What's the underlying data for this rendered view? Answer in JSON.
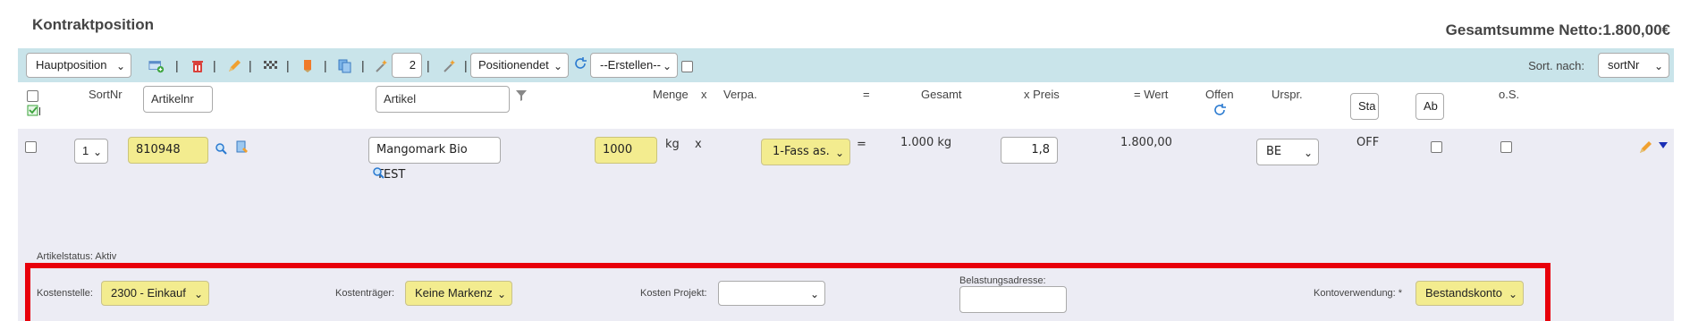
{
  "header": {
    "title": "Kontraktposition",
    "total": "Gesamtsumme Netto:1.800,00€"
  },
  "toolbar": {
    "position_type": "Hauptposition",
    "copies_value": "2",
    "positions_select": "Positionendet",
    "create_select": "--Erstellen--",
    "sort_label": "Sort. nach:",
    "sort_select": "sortNr",
    "separator": "|"
  },
  "columns": {
    "sortnr": "SortNr",
    "artikelnr_placeholder": "Artikelnr",
    "artikel_placeholder": "Artikel",
    "menge": "Menge",
    "x1": "x",
    "verpa": "Verpa.",
    "eq": "=",
    "gesamt": "Gesamt",
    "xpreis": "x Preis",
    "wert": "= Wert",
    "offen": "Offen",
    "urspr": "Urspr.",
    "sta_placeholder": "Sta",
    "ab_placeholder": "Ab",
    "os": "o.S."
  },
  "row": {
    "sortnr": "1",
    "artikelnr": "810948",
    "artikel": "Mangomark Bio TEST",
    "menge": "1000",
    "unit": "kg",
    "x": "x",
    "verpackung": "1-Fass as.",
    "eq": "=",
    "gesamt": "1.000 kg",
    "preis": "1,8",
    "wert": "1.800,00",
    "urspr": "BE",
    "status_toggle": "OFF",
    "artikelstatus": "Artikelstatus: Aktiv"
  },
  "cost": {
    "kostenstelle_label": "Kostenstelle:",
    "kostenstelle_value": "2300 - Einkauf",
    "kostentraeger_label": "Kostenträger:",
    "kostentraeger_value": "Keine Markenz",
    "projekt_label": "Kosten Projekt:",
    "projekt_value": "",
    "belastung_label": "Belastungsadresse:",
    "belastung_value": "",
    "konto_label": "Kontoverwendung: *",
    "konto_value": "Bestandskonto"
  },
  "colors": {
    "toolbar_bg": "#c9e4ea",
    "row_bg": "#ececf4",
    "highlight_field": "#f3ec8f",
    "annotation_red": "#e8000b"
  }
}
